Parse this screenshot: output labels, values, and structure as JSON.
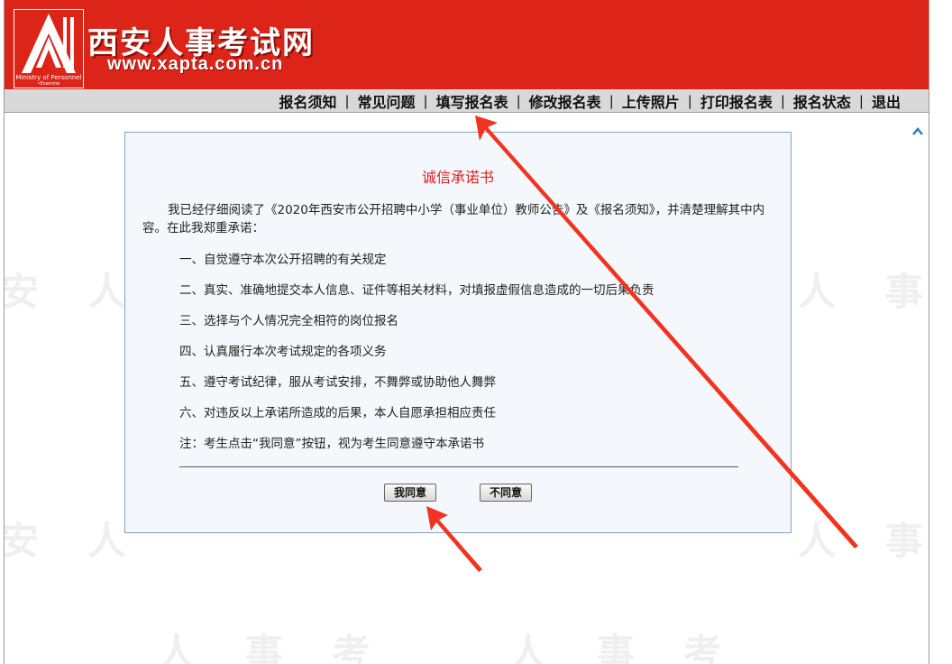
{
  "header": {
    "site_title": "西安人事考试网",
    "site_url": "www.xapta.com.cn",
    "logo_caption": "Ministry of Personnel",
    "logo_sub": "•Examine"
  },
  "nav": {
    "items": [
      {
        "label": "报名须知"
      },
      {
        "label": "常见问题"
      },
      {
        "label": "填写报名表"
      },
      {
        "label": "修改报名表"
      },
      {
        "label": "上传照片"
      },
      {
        "label": "打印报名表"
      },
      {
        "label": "报名状态"
      },
      {
        "label": "退出"
      }
    ],
    "separator": "|"
  },
  "pledge": {
    "title": "诚信承诺书",
    "intro": "我已经仔细阅读了《2020年西安市公开招聘中小学（事业单位）教师公告》及《报名须知》，并清楚理解其中内容。在此我郑重承诺：",
    "items": [
      "一、自觉遵守本次公开招聘的有关规定",
      "二、真实、准确地提交本人信息、证件等相关材料，对填报虚假信息造成的一切后果负责",
      "三、选择与个人情况完全相符的岗位报名",
      "四、认真履行本次考试规定的各项义务",
      "五、遵守考试纪律，服从考试安排，不舞弊或协助他人舞弊",
      "六、对违反以上承诺所造成的后果，本人自愿承担相应责任",
      "注：考生点击“我同意”按钮，视为考生同意遵守本承诺书"
    ],
    "agree_label": "我同意",
    "disagree_label": "不同意"
  },
  "colors": {
    "header_red": "#dc2419",
    "annotation_arrow": "#f2331f",
    "title_red": "#e02020",
    "panel_bg": "#f4f8fc",
    "panel_border": "#7fa3c6"
  },
  "icons": {
    "scroll_top": "chevron-up-icon"
  }
}
